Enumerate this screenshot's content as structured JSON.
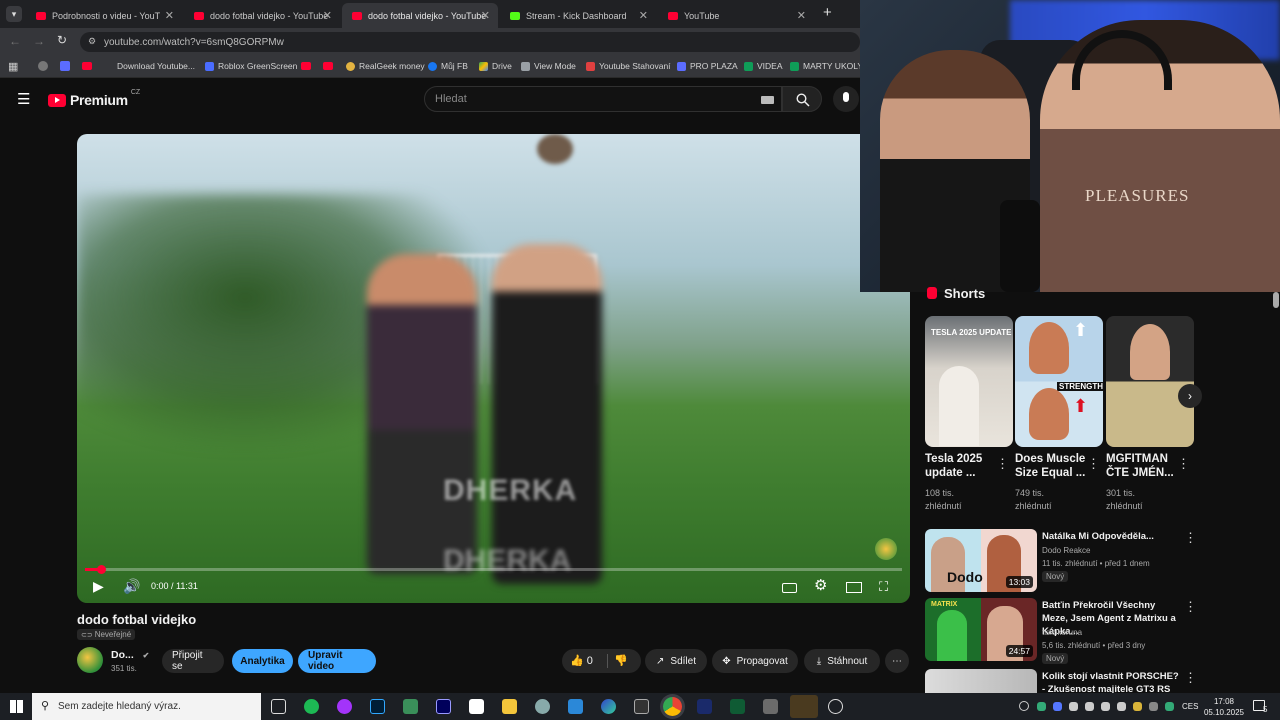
{
  "browser": {
    "tabs": [
      {
        "label": "Podrobnosti o videu - YouTube",
        "active": false
      },
      {
        "label": "dodo fotbal videjko - YouTube",
        "active": false
      },
      {
        "label": "dodo fotbal videjko - YouTube",
        "active": true
      },
      {
        "label": "Stream - Kick Dashboard",
        "active": false
      },
      {
        "label": "YouTube",
        "active": false
      }
    ],
    "new_tab": "+",
    "url": "youtube.com/watch?v=6smQ8GORPMw",
    "bookmarks": [
      "Download Youtube...",
      "Roblox GreenScreen",
      "RealGeek money",
      "Můj FB",
      "Drive",
      "View Mode",
      "Youtube Stahovaní",
      "PRO PLAZA",
      "VIDEA",
      "MARTY UKOLY"
    ]
  },
  "header": {
    "logo": "Premium",
    "country": "CZ",
    "search_placeholder": "Hledat"
  },
  "player": {
    "time": "0:00 / 11:31",
    "overlay_text": "DHERKA",
    "progress": 0.02
  },
  "video": {
    "title": "dodo fotbal videjko",
    "visibility": "Neveřejné",
    "channel": "Do...",
    "subscribers": "351 tis.",
    "buttons": {
      "join": "Připojit se",
      "analytics": "Analytika",
      "edit": "Upravit video",
      "likes": "0",
      "share": "Sdílet",
      "promote": "Propagovat",
      "download": "Stáhnout"
    }
  },
  "webcam": {
    "shirt_text": "PLEASURES"
  },
  "sidebar": {
    "shorts_heading": "Shorts",
    "shorts": [
      {
        "title": "Tesla 2025 update ...",
        "views": "108 tis.",
        "views_label": "zhlédnutí",
        "thumb_text": "TESLA 2025 UPDATE"
      },
      {
        "title": "Does Muscle Size Equal ...",
        "views": "749 tis.",
        "views_label": "zhlédnutí",
        "thumb_text": "STRENGTH"
      },
      {
        "title": "MGFITMAN ČTE JMÉN...",
        "views": "301 tis.",
        "views_label": "zhlédnutí",
        "thumb_text": ""
      }
    ],
    "videos": [
      {
        "title": "Natálka Mi Odpověděla...",
        "channel": "Dodo Reakce",
        "meta": "11 tis. zhlédnutí • před 1 dnem",
        "badge": "Nový",
        "duration": "13:03",
        "thumb_text": "Dodo"
      },
      {
        "title": "Batťin Překročil Všechny Meze, Jsem Agent z Matrixu a Kápka...",
        "channel": "tisicikoruna",
        "meta": "5,6 tis. zhlédnutí • před 3 dny",
        "badge": "Nový",
        "duration": "24:57",
        "thumb_text": "MATRIX"
      },
      {
        "title": "Kolik stojí vlastnit PORSCHE? - Zkušenost majitele GT3 RS",
        "channel": "",
        "meta": "",
        "badge": "",
        "duration": "",
        "thumb_text": ""
      }
    ]
  },
  "taskbar": {
    "search_placeholder": "Sem zadejte hledaný výraz.",
    "language": "CES",
    "time": "17:08",
    "date": "05.10.2025",
    "notifications": "5"
  },
  "colors": {
    "accent_red": "#ff0033",
    "accent_blue": "#3ea6ff",
    "kick_green": "#53fc18",
    "background": "#0f0f0f"
  }
}
